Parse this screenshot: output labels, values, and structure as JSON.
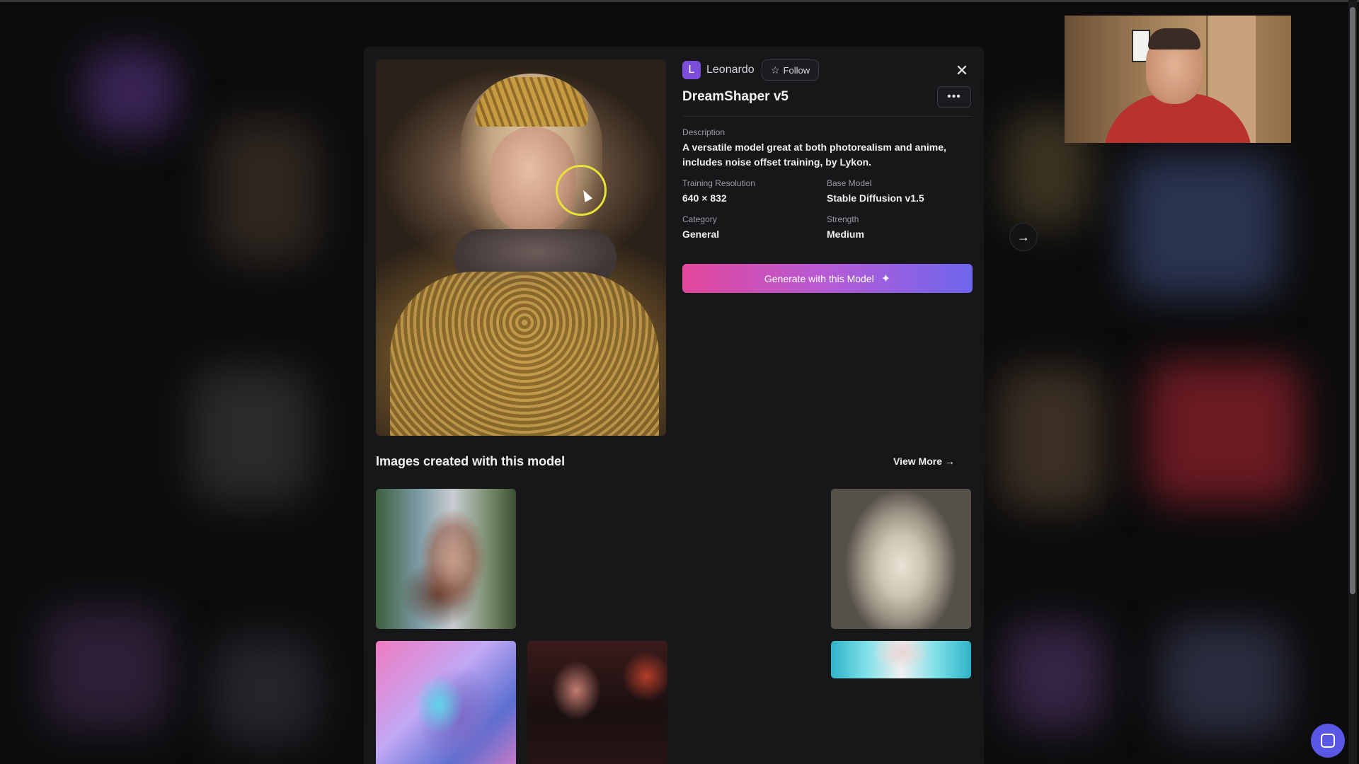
{
  "model": {
    "author": {
      "initial": "L",
      "name": "Leonardo"
    },
    "follow_label": "Follow",
    "title": "DreamShaper v5",
    "more_label": "•••",
    "close_label": "✕",
    "description_label": "Description",
    "description": "A versatile model great at both photorealism and anime, includes noise offset training, by Lykon.",
    "training_resolution_label": "Training Resolution",
    "training_resolution": "640 × 832",
    "base_model_label": "Base Model",
    "base_model": "Stable Diffusion v1.5",
    "category_label": "Category",
    "category": "General",
    "strength_label": "Strength",
    "strength": "Medium",
    "generate_label": "Generate with this Model"
  },
  "gallery": {
    "title": "Images created with this model",
    "view_more_label": "View More →"
  },
  "navigation": {
    "next_label": "→"
  },
  "colors": {
    "accent_start": "#e2479b",
    "accent_end": "#6e66ec",
    "modal_bg": "#17171a",
    "chat_button": "#5b57e6"
  }
}
